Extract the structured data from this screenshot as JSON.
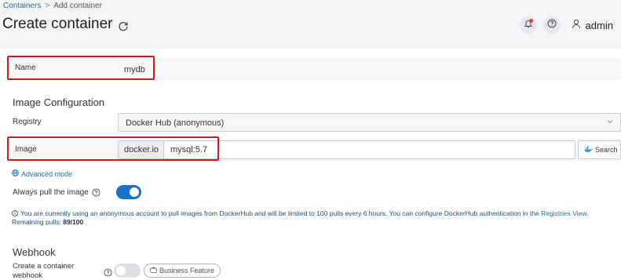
{
  "breadcrumb": {
    "link": "Containers",
    "separator": ">",
    "current": "Add container"
  },
  "page": {
    "title": "Create container",
    "refresh_icon": "refresh-icon"
  },
  "header": {
    "notification_icon": "bell-icon",
    "help_icon": "help-icon",
    "user_icon": "user-icon",
    "username": "admin"
  },
  "form": {
    "name": {
      "label": "Name",
      "value": "mydb"
    },
    "image_configuration": {
      "title": "Image Configuration",
      "registry": {
        "label": "Registry",
        "value": "Docker Hub (anonymous)"
      },
      "image": {
        "label": "Image",
        "prefix": "docker.io",
        "value": "mysql:5.7",
        "search_label": "Search"
      },
      "advanced_mode": "Advanced mode",
      "always_pull": {
        "label": "Always pull the image",
        "enabled": true
      },
      "notice": {
        "text": "You are currently using an anonymous account to pull images from DockerHub and will be limited to 100 pulls every 6 hours. You can configure DockerHub authentication in the",
        "link": "Registries View",
        "remaining_label": ". Remaining pulls:",
        "remaining_value": "89/100"
      }
    },
    "webhook": {
      "title": "Webhook",
      "label": "Create a container webhook",
      "enabled": false,
      "badge": "Business Feature"
    }
  },
  "colors": {
    "accent": "#1a73c9",
    "highlight": "#d7191c",
    "link": "#1f6fb5"
  }
}
